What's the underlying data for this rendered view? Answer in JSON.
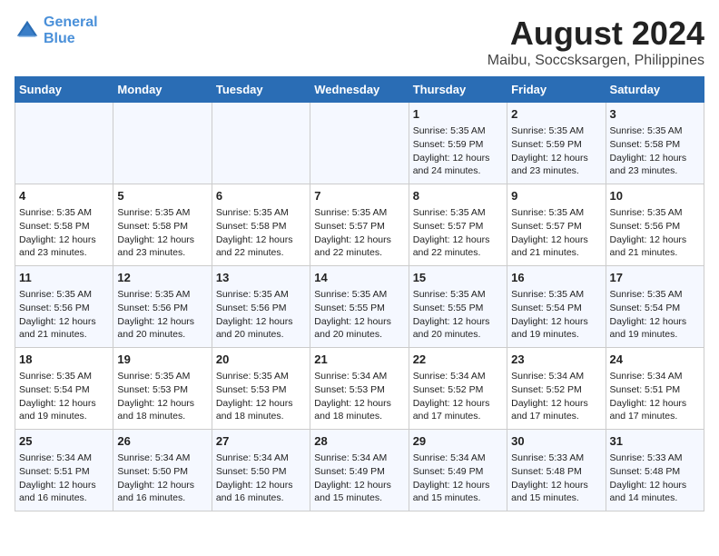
{
  "header": {
    "logo_line1": "General",
    "logo_line2": "Blue",
    "main_title": "August 2024",
    "subtitle": "Maibu, Soccsksargen, Philippines"
  },
  "days": [
    "Sunday",
    "Monday",
    "Tuesday",
    "Wednesday",
    "Thursday",
    "Friday",
    "Saturday"
  ],
  "weeks": [
    [
      {
        "date": "",
        "content": ""
      },
      {
        "date": "",
        "content": ""
      },
      {
        "date": "",
        "content": ""
      },
      {
        "date": "",
        "content": ""
      },
      {
        "date": "1",
        "content": "Sunrise: 5:35 AM\nSunset: 5:59 PM\nDaylight: 12 hours\nand 24 minutes."
      },
      {
        "date": "2",
        "content": "Sunrise: 5:35 AM\nSunset: 5:59 PM\nDaylight: 12 hours\nand 23 minutes."
      },
      {
        "date": "3",
        "content": "Sunrise: 5:35 AM\nSunset: 5:58 PM\nDaylight: 12 hours\nand 23 minutes."
      }
    ],
    [
      {
        "date": "4",
        "content": "Sunrise: 5:35 AM\nSunset: 5:58 PM\nDaylight: 12 hours\nand 23 minutes."
      },
      {
        "date": "5",
        "content": "Sunrise: 5:35 AM\nSunset: 5:58 PM\nDaylight: 12 hours\nand 23 minutes."
      },
      {
        "date": "6",
        "content": "Sunrise: 5:35 AM\nSunset: 5:58 PM\nDaylight: 12 hours\nand 22 minutes."
      },
      {
        "date": "7",
        "content": "Sunrise: 5:35 AM\nSunset: 5:57 PM\nDaylight: 12 hours\nand 22 minutes."
      },
      {
        "date": "8",
        "content": "Sunrise: 5:35 AM\nSunset: 5:57 PM\nDaylight: 12 hours\nand 22 minutes."
      },
      {
        "date": "9",
        "content": "Sunrise: 5:35 AM\nSunset: 5:57 PM\nDaylight: 12 hours\nand 21 minutes."
      },
      {
        "date": "10",
        "content": "Sunrise: 5:35 AM\nSunset: 5:56 PM\nDaylight: 12 hours\nand 21 minutes."
      }
    ],
    [
      {
        "date": "11",
        "content": "Sunrise: 5:35 AM\nSunset: 5:56 PM\nDaylight: 12 hours\nand 21 minutes."
      },
      {
        "date": "12",
        "content": "Sunrise: 5:35 AM\nSunset: 5:56 PM\nDaylight: 12 hours\nand 20 minutes."
      },
      {
        "date": "13",
        "content": "Sunrise: 5:35 AM\nSunset: 5:56 PM\nDaylight: 12 hours\nand 20 minutes."
      },
      {
        "date": "14",
        "content": "Sunrise: 5:35 AM\nSunset: 5:55 PM\nDaylight: 12 hours\nand 20 minutes."
      },
      {
        "date": "15",
        "content": "Sunrise: 5:35 AM\nSunset: 5:55 PM\nDaylight: 12 hours\nand 20 minutes."
      },
      {
        "date": "16",
        "content": "Sunrise: 5:35 AM\nSunset: 5:54 PM\nDaylight: 12 hours\nand 19 minutes."
      },
      {
        "date": "17",
        "content": "Sunrise: 5:35 AM\nSunset: 5:54 PM\nDaylight: 12 hours\nand 19 minutes."
      }
    ],
    [
      {
        "date": "18",
        "content": "Sunrise: 5:35 AM\nSunset: 5:54 PM\nDaylight: 12 hours\nand 19 minutes."
      },
      {
        "date": "19",
        "content": "Sunrise: 5:35 AM\nSunset: 5:53 PM\nDaylight: 12 hours\nand 18 minutes."
      },
      {
        "date": "20",
        "content": "Sunrise: 5:35 AM\nSunset: 5:53 PM\nDaylight: 12 hours\nand 18 minutes."
      },
      {
        "date": "21",
        "content": "Sunrise: 5:34 AM\nSunset: 5:53 PM\nDaylight: 12 hours\nand 18 minutes."
      },
      {
        "date": "22",
        "content": "Sunrise: 5:34 AM\nSunset: 5:52 PM\nDaylight: 12 hours\nand 17 minutes."
      },
      {
        "date": "23",
        "content": "Sunrise: 5:34 AM\nSunset: 5:52 PM\nDaylight: 12 hours\nand 17 minutes."
      },
      {
        "date": "24",
        "content": "Sunrise: 5:34 AM\nSunset: 5:51 PM\nDaylight: 12 hours\nand 17 minutes."
      }
    ],
    [
      {
        "date": "25",
        "content": "Sunrise: 5:34 AM\nSunset: 5:51 PM\nDaylight: 12 hours\nand 16 minutes."
      },
      {
        "date": "26",
        "content": "Sunrise: 5:34 AM\nSunset: 5:50 PM\nDaylight: 12 hours\nand 16 minutes."
      },
      {
        "date": "27",
        "content": "Sunrise: 5:34 AM\nSunset: 5:50 PM\nDaylight: 12 hours\nand 16 minutes."
      },
      {
        "date": "28",
        "content": "Sunrise: 5:34 AM\nSunset: 5:49 PM\nDaylight: 12 hours\nand 15 minutes."
      },
      {
        "date": "29",
        "content": "Sunrise: 5:34 AM\nSunset: 5:49 PM\nDaylight: 12 hours\nand 15 minutes."
      },
      {
        "date": "30",
        "content": "Sunrise: 5:33 AM\nSunset: 5:48 PM\nDaylight: 12 hours\nand 15 minutes."
      },
      {
        "date": "31",
        "content": "Sunrise: 5:33 AM\nSunset: 5:48 PM\nDaylight: 12 hours\nand 14 minutes."
      }
    ]
  ]
}
